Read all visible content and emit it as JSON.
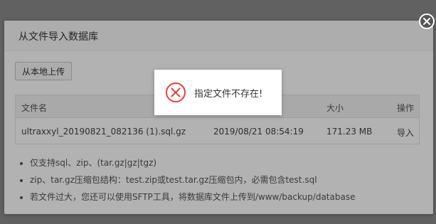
{
  "dialog": {
    "title": "从文件导入数据库",
    "upload_button": "从本地上传"
  },
  "table": {
    "headers": {
      "name": "文件名",
      "time": "",
      "size": "大小",
      "action": "操作"
    },
    "rows": [
      {
        "name": "ultraxxyl_20190821_082136 (1).sql.gz",
        "time": "2019/08/21 08:54:19",
        "size": "171.23 MB",
        "action": "导入"
      }
    ]
  },
  "notes": [
    "仅支持sql、zip、(tar.gz|gz|tgz)",
    "zip、tar.gz压缩包结构：test.zip或test.tar.gz压缩包内，必需包含test.sql",
    "若文件过大，您还可以使用SFTP工具，将数据库文件上传到/www/backup/database"
  ],
  "toast": {
    "message": "指定文件不存在!",
    "icon": "error-circle-icon"
  },
  "colors": {
    "accent_green": "#20a53a",
    "error_red": "#e8413b"
  }
}
